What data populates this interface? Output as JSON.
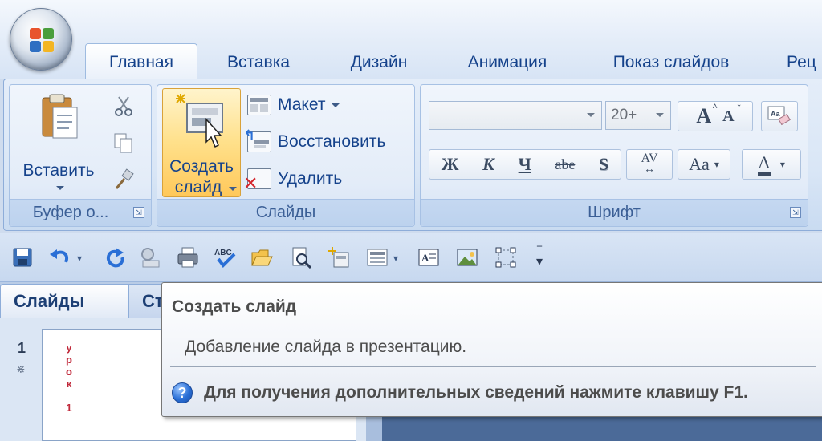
{
  "tabs": [
    {
      "label": "Главная",
      "active": true
    },
    {
      "label": "Вставка"
    },
    {
      "label": "Дизайн"
    },
    {
      "label": "Анимация"
    },
    {
      "label": "Показ слайдов"
    },
    {
      "label": "Рец"
    }
  ],
  "clipboard": {
    "paste_label": "Вставить",
    "group_label": "Буфер о...",
    "launcher": "⇲"
  },
  "slides": {
    "new_slide_line1": "Создать",
    "new_slide_line2": "слайд",
    "layout_label": "Макет",
    "reset_label": "Восстановить",
    "delete_label": "Удалить",
    "group_label": "Слайды"
  },
  "font": {
    "font_name": "",
    "font_size": "20+",
    "grow": "A",
    "shrink": "A",
    "bold": "Ж",
    "italic": "К",
    "underline": "Ч",
    "strike": "abe",
    "shadow": "S",
    "spacing": "AV",
    "case": "Aa",
    "color": "A",
    "group_label": "Шрифт",
    "launcher": "⇲"
  },
  "quick_access": {
    "icons": [
      "save-icon",
      "undo-icon",
      "redo-icon",
      "print-preview-icon",
      "print-icon",
      "spelling-icon",
      "open-icon",
      "preview-icon",
      "new-slide-icon",
      "layout-icon",
      "textbox-icon",
      "picture-icon",
      "select-icon",
      "customize-icon"
    ]
  },
  "panes": {
    "slides_tab": "Слайды",
    "outline_tab": "Ст",
    "slide_number": "1",
    "slide_text_chars": [
      "у",
      "р",
      "о",
      "к",
      "",
      "1"
    ]
  },
  "tooltip": {
    "title": "Создать слайд",
    "description": "Добавление слайда в презентацию.",
    "help_text": "Для получения дополнительных сведений нажмите клавишу F1.",
    "help_icon_glyph": "?"
  },
  "colors": {
    "ribbon_text": "#15428b",
    "highlight": "#ffd35a",
    "help_blue": "#2a6fd6"
  }
}
